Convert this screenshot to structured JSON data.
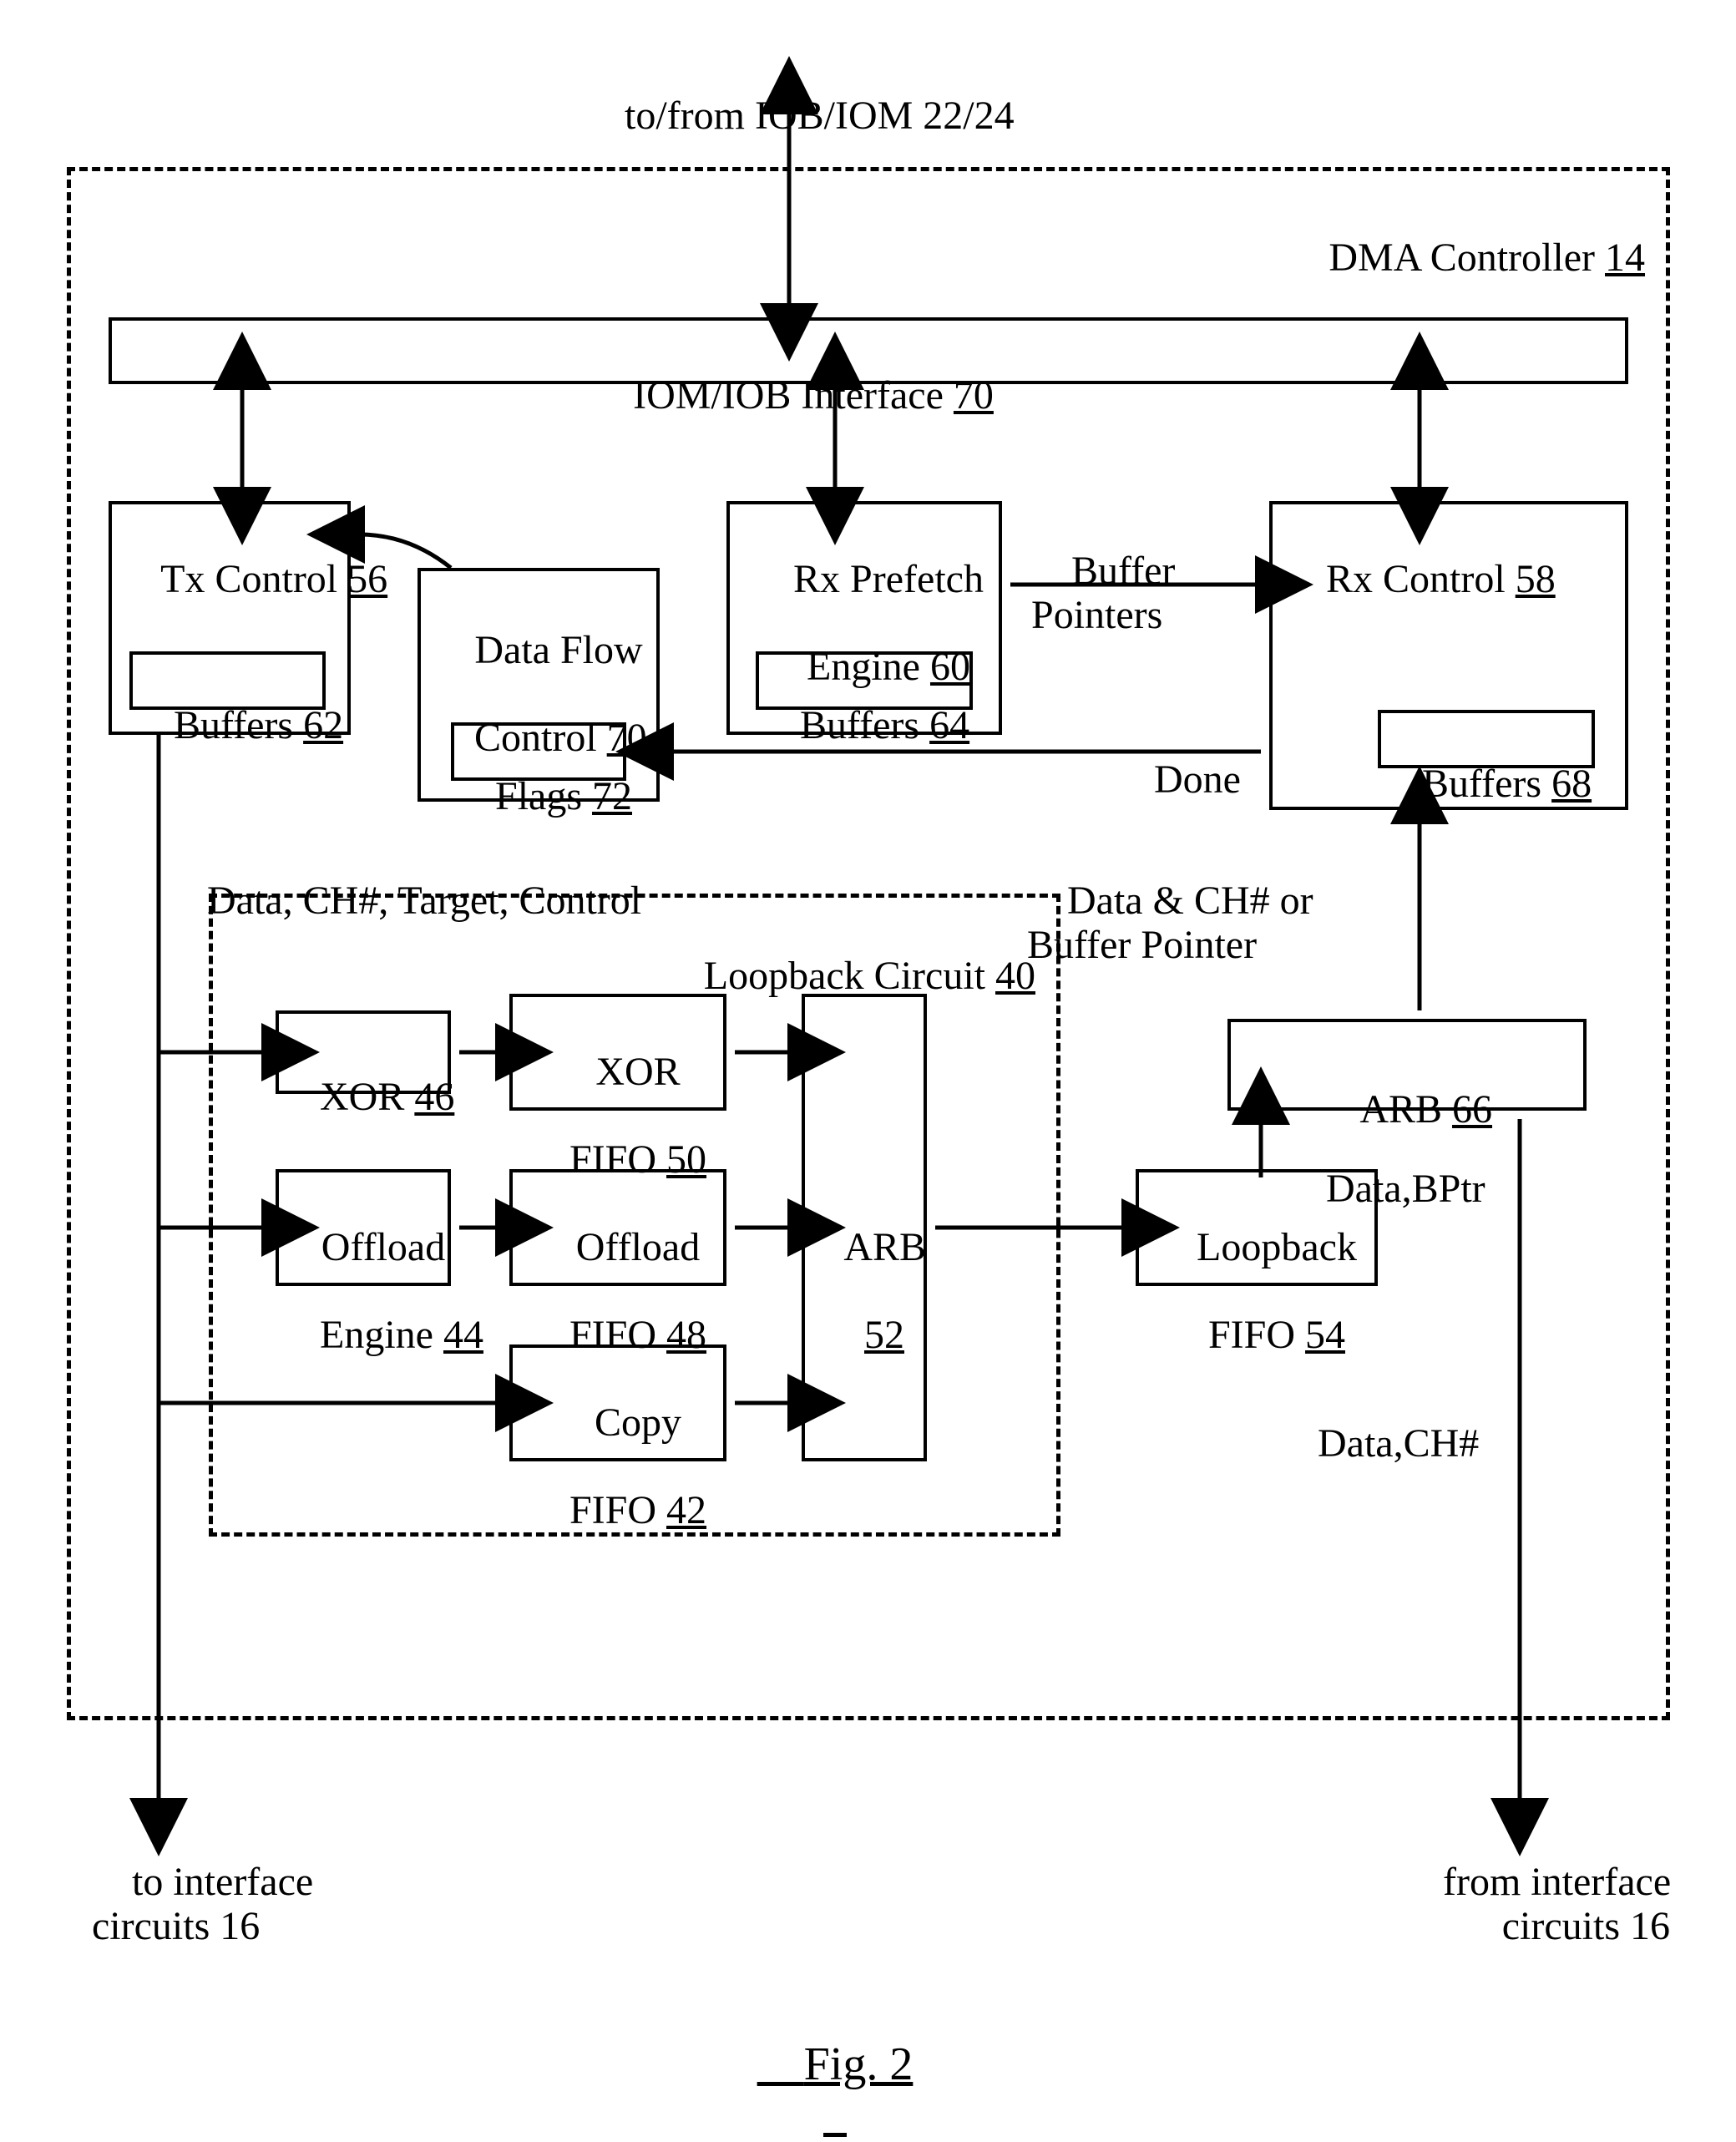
{
  "labels": {
    "top_iob": "to/from IOB/IOM 22/24",
    "controller_title_pre": "DMA Controller ",
    "controller_title_num": "14",
    "iom_iob_pre": "IOM/IOB Interface ",
    "iom_iob_num": "70",
    "tx_control_pre": "Tx Control ",
    "tx_control_num": "56",
    "buffers62_pre": "Buffers ",
    "buffers62_num": "62",
    "dataflow_line1": "Data Flow",
    "dataflow_line2_pre": "Control ",
    "dataflow_line2_num": "70",
    "flags_pre": "Flags ",
    "flags_num": "72",
    "rx_prefetch_line1": "Rx Prefetch",
    "rx_prefetch_line2_pre": "Engine ",
    "rx_prefetch_line2_num": "60",
    "buffers64_pre": "Buffers ",
    "buffers64_num": "64",
    "rx_control_pre": "Rx Control ",
    "rx_control_num": "58",
    "buffers68_pre": "Buffers ",
    "buffers68_num": "68",
    "buffer_pointers": "Buffer\nPointers",
    "done": "Done",
    "data_ch_line": "Data, CH#, Target, Control",
    "loopback_title_pre": "Loopback Circuit ",
    "loopback_title_num": "40",
    "xor_pre": "XOR ",
    "xor_num": "46",
    "xor_fifo_line1": "XOR",
    "xor_fifo_line2_pre": "FIFO ",
    "xor_fifo_line2_num": "50",
    "offload_line1": "Offload",
    "offload_line2_pre": "Engine ",
    "offload_line2_num": "44",
    "offload_fifo_line1": "Offload",
    "offload_fifo_line2_pre": "FIFO ",
    "offload_fifo_line2_num": "48",
    "copy_fifo_line1": "Copy",
    "copy_fifo_line2_pre": "FIFO ",
    "copy_fifo_line2_num": "42",
    "arb52_line1": "ARB",
    "arb52_num": "52",
    "loopback_fifo_line1": "Loopback",
    "loopback_fifo_line2_pre": "FIFO ",
    "loopback_fifo_line2_num": "54",
    "arb66_pre": "ARB ",
    "arb66_num": "66",
    "data_ch_or": "Data & CH# or\nBuffer Pointer",
    "data_bptr": "Data,BPtr",
    "data_ch": "Data,CH#",
    "to_if": "to interface\ncircuits 16",
    "from_if": "from interface\ncircuits 16",
    "fig": "Fig. 2"
  }
}
